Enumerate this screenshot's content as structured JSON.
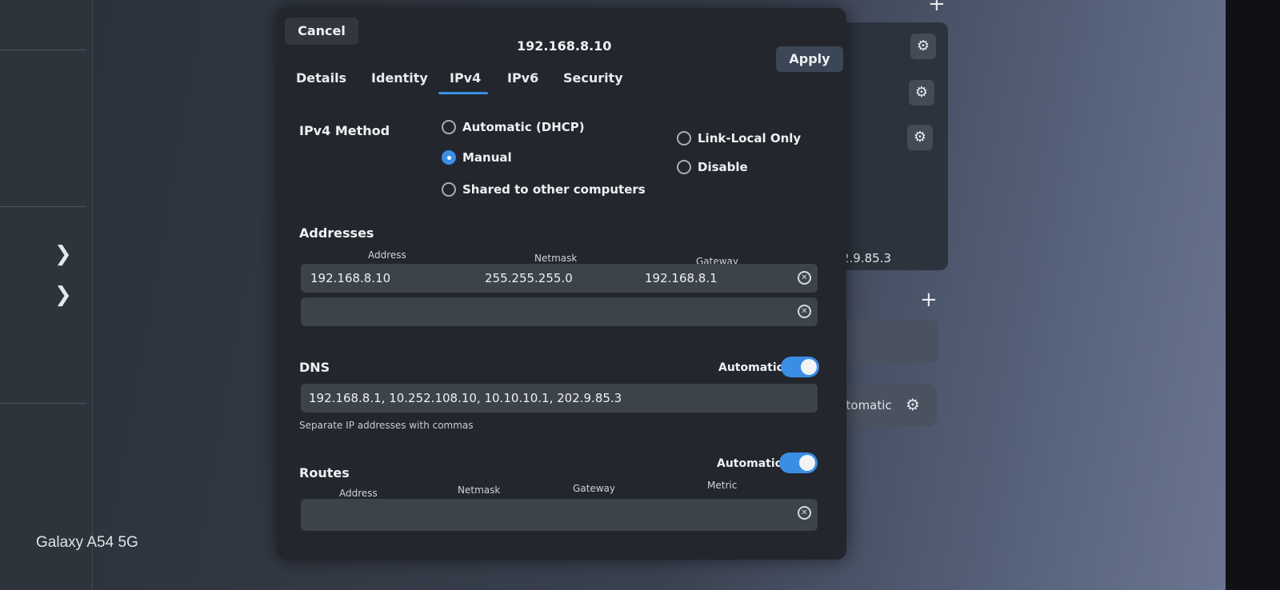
{
  "dialog": {
    "title": "192.168.8.10",
    "cancel_label": "Cancel",
    "apply_label": "Apply",
    "tabs": [
      "Details",
      "Identity",
      "IPv4",
      "IPv6",
      "Security"
    ],
    "active_tab": "IPv4"
  },
  "ipv4_method": {
    "label": "IPv4 Method",
    "options": [
      "Automatic (DHCP)",
      "Manual",
      "Shared to other computers",
      "Link-Local Only",
      "Disable"
    ],
    "selected": "Manual"
  },
  "addresses": {
    "label": "Addresses",
    "columns": [
      "Address",
      "Netmask",
      "Gateway"
    ],
    "rows": [
      {
        "address": "192.168.8.10",
        "netmask": "255.255.255.0",
        "gateway": "192.168.8.1"
      }
    ]
  },
  "dns": {
    "label": "DNS",
    "automatic_label": "Automatic",
    "automatic_on": true,
    "value": "192.168.8.1, 10.252.108.10, 10.10.10.1, 202.9.85.3",
    "hint": "Separate IP addresses with commas"
  },
  "routes": {
    "label": "Routes",
    "automatic_label": "Automatic",
    "automatic_on": true,
    "columns": [
      "Address",
      "Netmask",
      "Gateway",
      "Metric"
    ]
  },
  "background": {
    "dns_fragment": "2.9.85.3",
    "automatic_fragment": "utomatic"
  },
  "watermark": "Galaxy A54 5G",
  "colors": {
    "accent": "#3a8ee6",
    "dialog_bg": "#23272d",
    "row_bg": "#3d434b"
  },
  "icons": [
    "gear-icon",
    "plus-icon",
    "chevron-right-icon",
    "clear-icon"
  ]
}
